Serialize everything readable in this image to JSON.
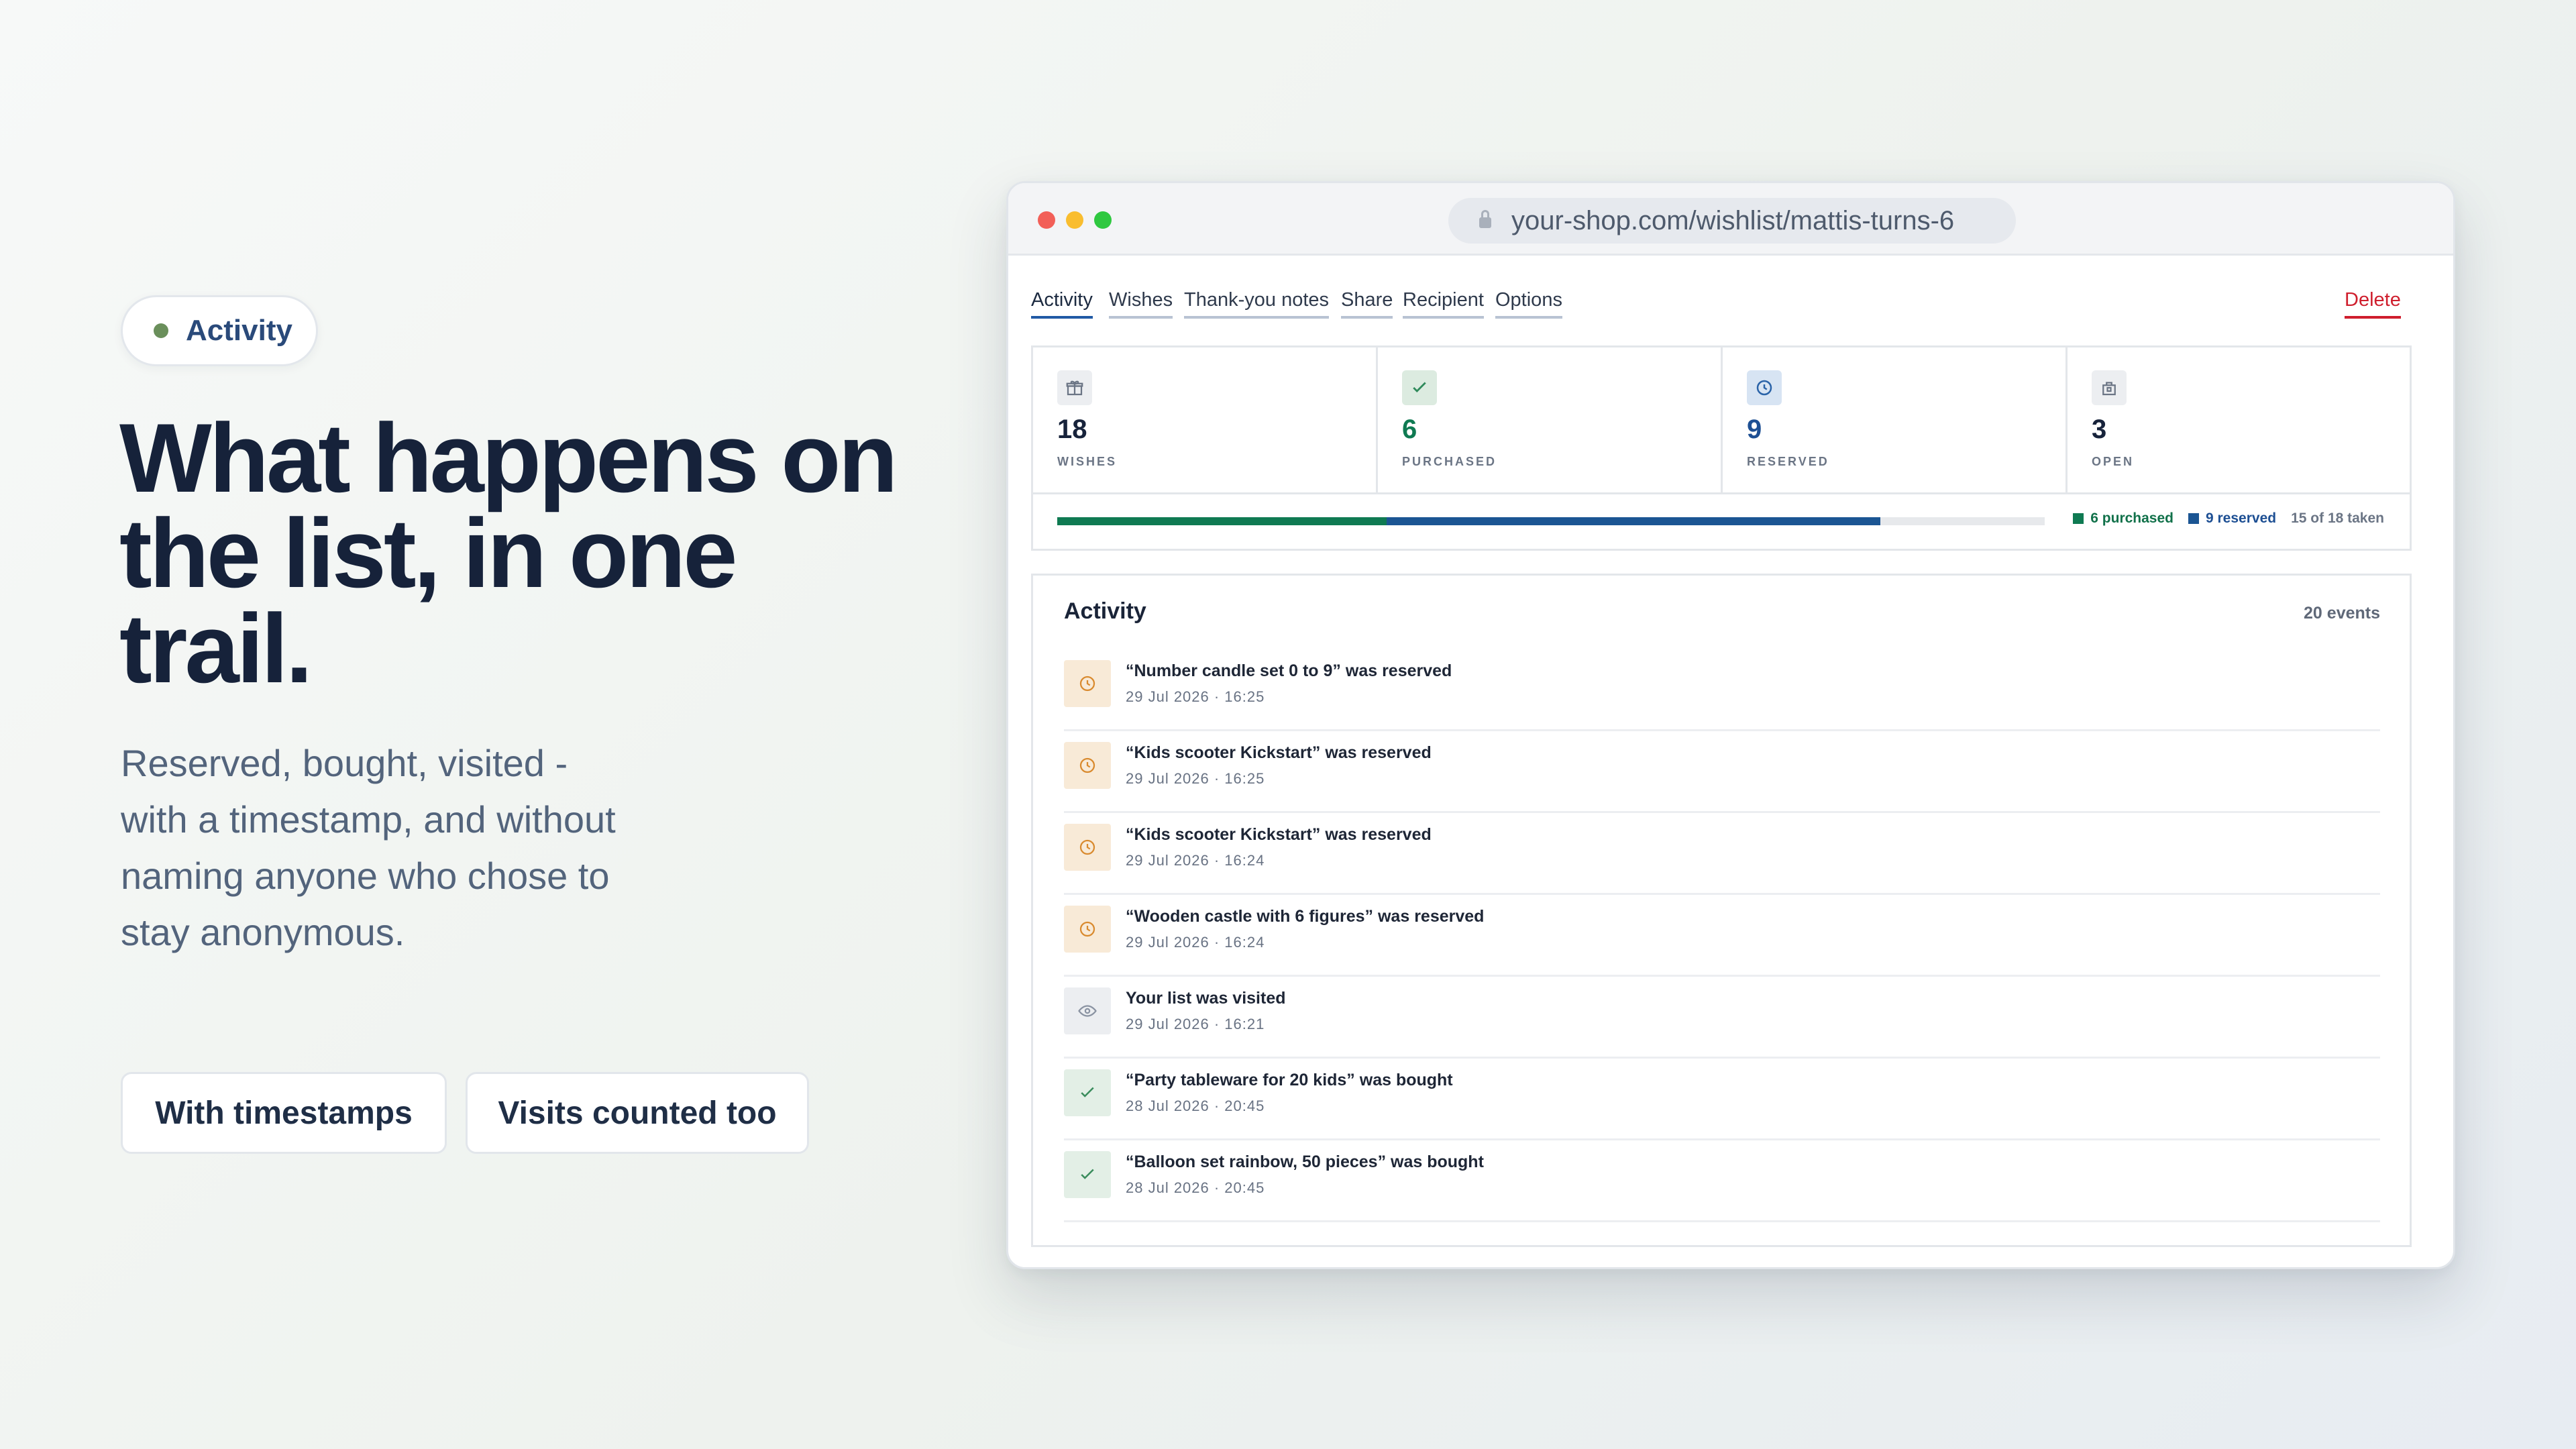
{
  "hero": {
    "badge": "Activity",
    "title": "What happens on the list, in one trail.",
    "subtitle": "Reserved, bought, visited - with a timestamp, and without naming anyone who chose to stay anonymous.",
    "chips": [
      "With timestamps",
      "Visits counted too"
    ]
  },
  "browser": {
    "url": "your-shop.com/wishlist/mattis-turns-6"
  },
  "tabs": [
    {
      "label": "Activity",
      "active": true
    },
    {
      "label": "Wishes"
    },
    {
      "label": "Thank-you notes"
    },
    {
      "label": "Share"
    },
    {
      "label": "Recipient"
    },
    {
      "label": "Options"
    }
  ],
  "delete_label": "Delete",
  "stats": [
    {
      "icon": "gift-icon",
      "value": "18",
      "label": "WISHES",
      "color": "#1a2438"
    },
    {
      "icon": "check-icon",
      "value": "6",
      "label": "PURCHASED",
      "color": "#0f7a52"
    },
    {
      "icon": "clock-icon",
      "value": "9",
      "label": "RESERVED",
      "color": "#1d4f93"
    },
    {
      "icon": "open-box-icon",
      "value": "3",
      "label": "OPEN",
      "color": "#1a2438"
    }
  ],
  "progress": {
    "total": 18,
    "purchased": 6,
    "reserved": 9,
    "purchased_color": "#0f7a52",
    "reserved_color": "#1b5593",
    "legend_purchased": "6 purchased",
    "legend_reserved": "9 reserved",
    "legend_taken": "15 of 18 taken"
  },
  "activity": {
    "title": "Activity",
    "count": "20 events",
    "events": [
      {
        "type": "reserved",
        "icon": "clock-icon",
        "text": "“Number candle set 0 to 9” was reserved",
        "date": "29 Jul 2026 · 16:25"
      },
      {
        "type": "reserved",
        "icon": "clock-icon",
        "text": "“Kids scooter Kickstart” was reserved",
        "date": "29 Jul 2026 · 16:25"
      },
      {
        "type": "reserved",
        "icon": "clock-icon",
        "text": "“Kids scooter Kickstart” was reserved",
        "date": "29 Jul 2026 · 16:24"
      },
      {
        "type": "reserved",
        "icon": "clock-icon",
        "text": "“Wooden castle with 6 figures” was reserved",
        "date": "29 Jul 2026 · 16:24"
      },
      {
        "type": "visited",
        "icon": "eye-icon",
        "text": "Your list was visited",
        "date": "29 Jul 2026 · 16:21"
      },
      {
        "type": "bought",
        "icon": "check-icon",
        "text": "“Party tableware for 20 kids” was bought",
        "date": "28 Jul 2026 · 20:45"
      },
      {
        "type": "bought",
        "icon": "check-icon",
        "text": "“Balloon set rainbow, 50 pieces” was bought",
        "date": "28 Jul 2026 · 20:45"
      }
    ]
  }
}
